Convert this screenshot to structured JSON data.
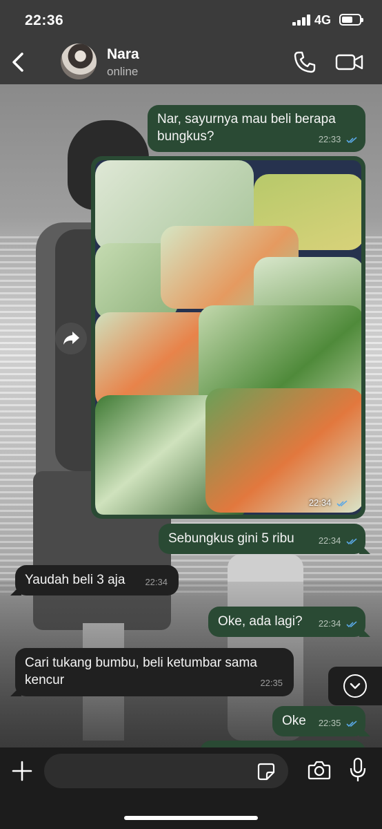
{
  "status_bar": {
    "time": "22:36",
    "network": "4G"
  },
  "header": {
    "contact_name": "Nara",
    "contact_status": "online"
  },
  "messages": [
    {
      "direction": "out",
      "text": "Nar, sayurnya mau beli berapa bungkus?",
      "time": "22:33",
      "read": true
    },
    {
      "direction": "out",
      "type": "image",
      "time": "22:34",
      "read": true
    },
    {
      "direction": "out",
      "text": "Sebungkus gini 5 ribu",
      "time": "22:34",
      "read": true
    },
    {
      "direction": "in",
      "text": "Yaudah beli 3 aja",
      "time": "22:34"
    },
    {
      "direction": "out",
      "text": "Oke, ada lagi?",
      "time": "22:34",
      "read": true
    },
    {
      "direction": "in",
      "text": "Cari tukang bumbu, beli ketumbar sama kencur",
      "time": "22:35"
    },
    {
      "direction": "out",
      "text": "Oke",
      "time": "22:35",
      "read": true
    }
  ],
  "colors": {
    "outgoing_bubble": "#2a4a34",
    "incoming_bubble": "#202020",
    "read_ticks": "#5aa8e6",
    "header": "#3b3b3b"
  },
  "icons": [
    "back-icon",
    "phone-icon",
    "video-call-icon",
    "forward-icon",
    "scroll-down-icon",
    "plus-icon",
    "sticker-icon",
    "camera-icon",
    "microphone-icon"
  ]
}
